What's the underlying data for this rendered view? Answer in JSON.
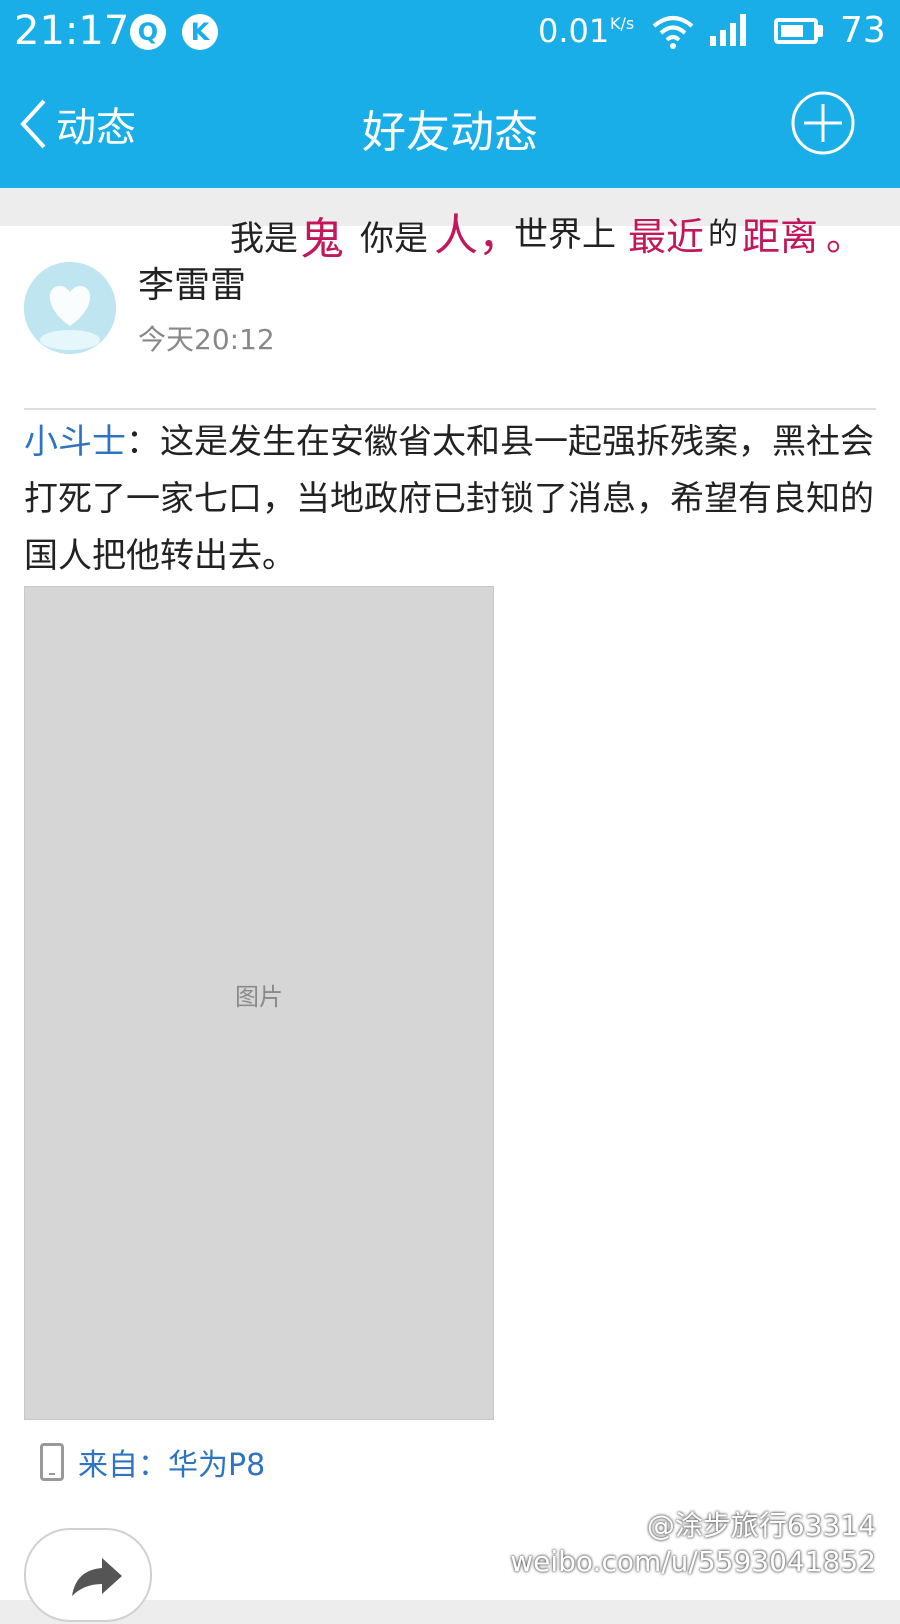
{
  "status_bar": {
    "time": "21:17",
    "net_speed": "0.01",
    "net_unit": "K/s",
    "battery": "73",
    "battery_level": 0.73,
    "icons": [
      "q-app-icon",
      "k-app-icon",
      "wifi-icon",
      "signal-icon",
      "battery-icon"
    ]
  },
  "header": {
    "back_label": "动态",
    "title": "好友动态",
    "add_icon": "plus-circle-icon"
  },
  "post": {
    "banner_text": "我是鬼 你是人，世界上最近的距离。",
    "user_name": "李雷雷",
    "timestamp": "今天20:12",
    "quoted_author": "小斗士",
    "separator": "：",
    "body": "这是发生在安徽省太和县一起强拆残案，黑社会打死了一家七口，当地政府已封锁了消息，希望有良知的国人把他转出去。",
    "photo_note": "图片",
    "source_label": "来自：华为P8"
  },
  "watermark": {
    "line1": "@涂步旅行63314",
    "line2": "weibo.com/u/5593041852"
  },
  "colors": {
    "header_bg": "#1aaee8",
    "link": "#2f74c0",
    "text": "#222222",
    "muted": "#888888",
    "banner_accent": "#c2185b"
  }
}
